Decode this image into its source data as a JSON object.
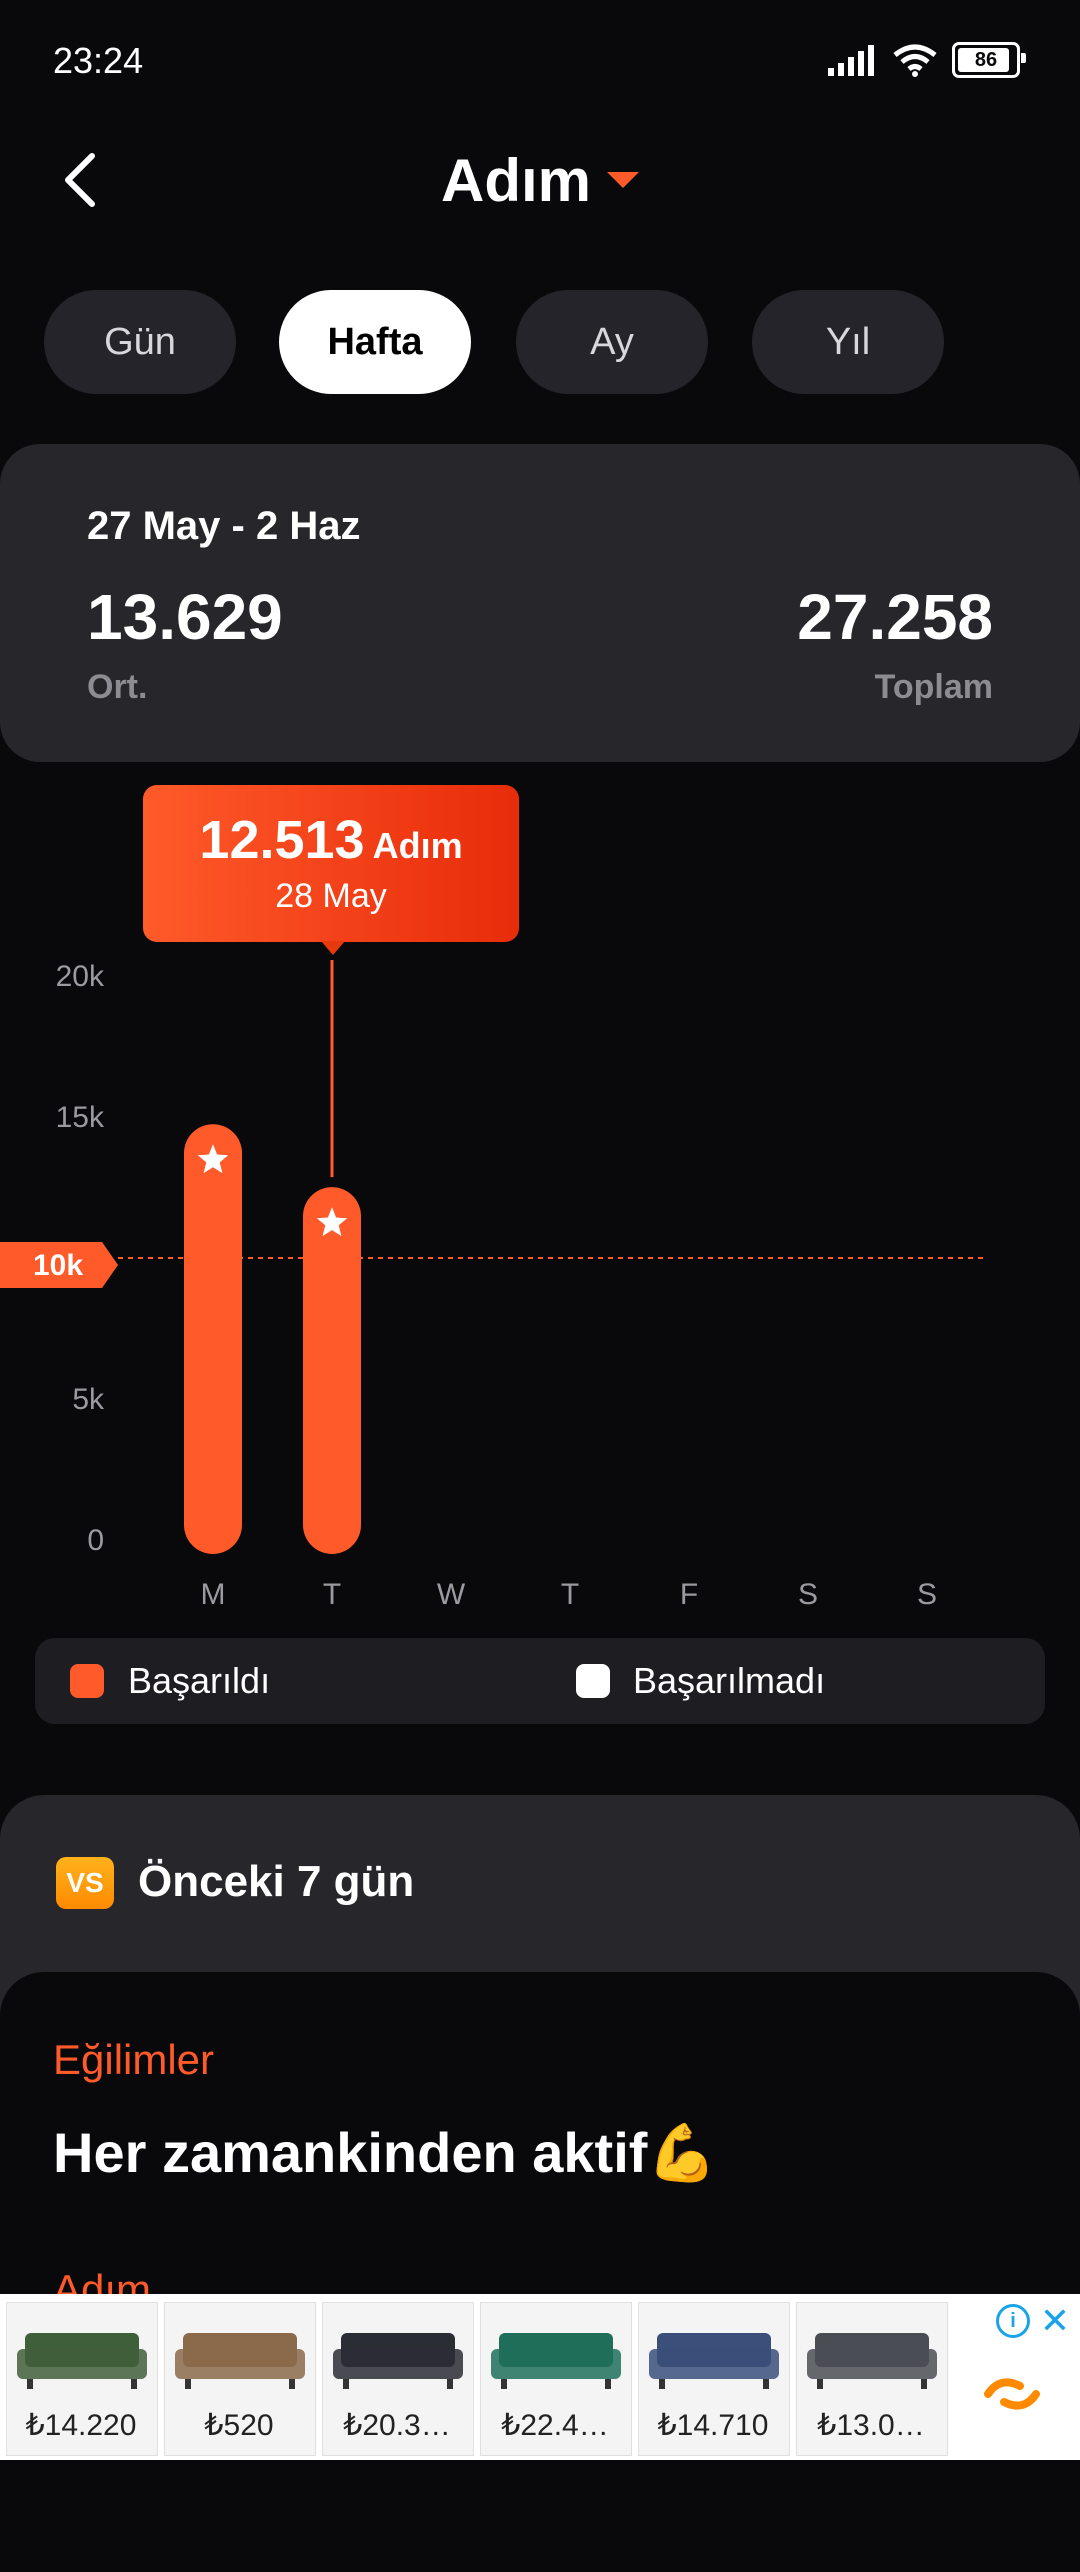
{
  "status": {
    "time": "23:24",
    "battery": "86"
  },
  "header": {
    "title": "Adım"
  },
  "tabs": [
    "Gün",
    "Hafta",
    "Ay",
    "Yıl"
  ],
  "summary": {
    "range": "27 May - 2 Haz",
    "avg": "13.629",
    "avg_label": "Ort.",
    "total": "27.258",
    "total_label": "Toplam"
  },
  "tooltip": {
    "value": "12.513",
    "unit": "Adım",
    "date": "28 May"
  },
  "goal_label": "10k",
  "chart_data": {
    "type": "bar",
    "categories": [
      "M",
      "T",
      "W",
      "T",
      "F",
      "S",
      "S"
    ],
    "values": [
      14745,
      12513,
      0,
      0,
      0,
      0,
      0
    ],
    "yticks": [
      "0",
      "5k",
      "10k",
      "15k",
      "20k"
    ],
    "ylim": [
      0,
      20000
    ],
    "goal": 10000,
    "selected_index": 1,
    "colors": {
      "achieved": "#ff5a2a",
      "not_achieved": "#ffffff"
    }
  },
  "legend": {
    "achieved": "Başarıldı",
    "not_achieved": "Başarılmadı"
  },
  "compare": {
    "badge": "VS",
    "title": "Önceki 7 gün"
  },
  "trends": {
    "label": "Eğilimler",
    "headline": "Her zamankinden aktif💪",
    "sub": "Adım"
  },
  "ad": {
    "prices": [
      "₺14.220",
      "₺520",
      "₺20.3…",
      "₺22.4…",
      "₺14.710",
      "₺13.0…"
    ]
  }
}
